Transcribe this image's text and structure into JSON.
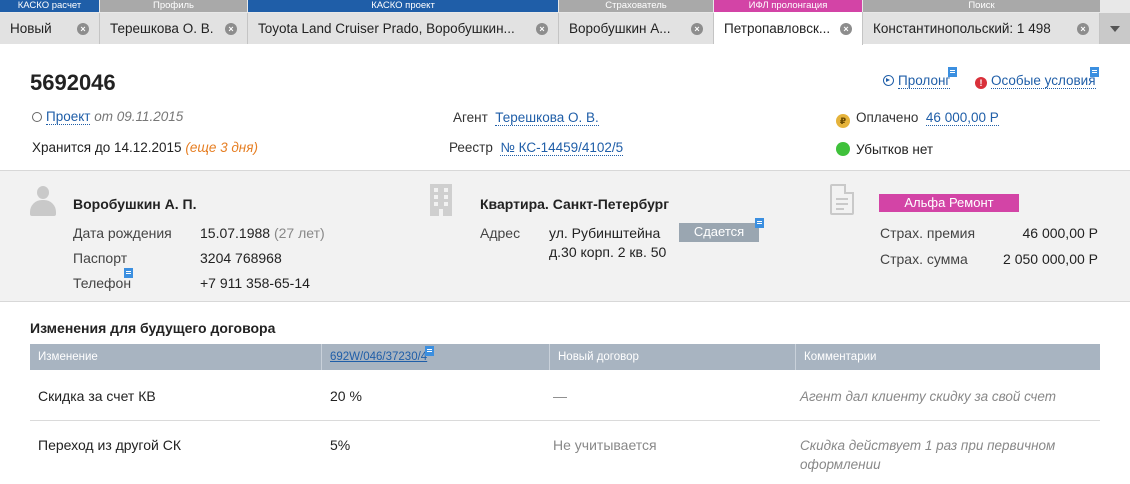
{
  "tabs": {
    "groups": [
      {
        "label": "КАСКО расчет"
      },
      {
        "label": "Профиль"
      },
      {
        "label": "КАСКО проект"
      },
      {
        "label": "Страхователь"
      },
      {
        "label": "ИФЛ пролонгация"
      },
      {
        "label": "Поиск"
      }
    ],
    "items": [
      {
        "label": "Новый"
      },
      {
        "label": "Терешкова О. В."
      },
      {
        "label": "Toyota Land Cruiser Prado, Воробушкин..."
      },
      {
        "label": "Воробушкин А..."
      },
      {
        "label": "Петропавловск..."
      },
      {
        "label": "Константинопольский: 1 498"
      }
    ],
    "close_glyph": "×"
  },
  "contract": {
    "number": "5692046",
    "status_link": "Проект",
    "status_date": "от 09.11.2015",
    "stored_until": "Хранится до 14.12.2015",
    "stored_remaining": "(еще 3 дня)",
    "agent_label": "Агент",
    "agent_name": "Терешкова О. В.",
    "registry_label": "Реестр",
    "registry_value": "№ КС-14459/4102/5",
    "paid_label": "Оплачено",
    "paid_value": "46 000,00 Р",
    "coin_symbol": "₽",
    "losses": "Убытков нет",
    "prolong_link": "Пролонг",
    "special_link": "Особые условия",
    "warn_symbol": "!"
  },
  "insured": {
    "name": "Воробушкин А. П.",
    "birth_label": "Дата рождения",
    "birth_value": "15.07.1988",
    "birth_age": "(27 лет)",
    "passport_label": "Паспорт",
    "passport_value": "3204 768968",
    "phone_label": "Телефон",
    "phone_value": "+7 911 358-65-14"
  },
  "property": {
    "title": "Квартира. Санкт-Петербург",
    "address_label": "Адрес",
    "address_line1": "ул. Рубинштейна",
    "address_line2": "д.30 корп. 2 кв. 50",
    "rent_badge": "Сдается"
  },
  "policy": {
    "program_badge": "Альфа Ремонт",
    "premium_label": "Страх. премия",
    "premium_value": "46 000,00 Р",
    "sum_label": "Страх. сумма",
    "sum_value": "2 050 000,00 Р"
  },
  "changes": {
    "title": "Изменения для будущего договора",
    "headers": {
      "change": "Изменение",
      "current": "692W/046/37230/4",
      "new": "Новый договор",
      "comments": "Комментарии"
    },
    "rows": [
      {
        "change": "Скидка за счет КВ",
        "current": "20 %",
        "new": "—",
        "comment_line1": "Агент дал клиенту скидку за свой счет",
        "comment_line2": ""
      },
      {
        "change": "Переход из другой СК",
        "current": "5%",
        "new": "Не учитывается",
        "comment_line1": "Скидка действует 1 раз при первичном",
        "comment_line2": "оформлении"
      }
    ]
  },
  "colors": {
    "brand_blue": "#1f5ea8",
    "pink": "#d344a6",
    "tab_grey": "#a9a9a9",
    "orange": "#e67e22",
    "green": "#3fc13b",
    "table_header": "#a8b4c1"
  },
  "icons": [
    "close-icon",
    "chevron-down-icon",
    "radio-icon",
    "coin-icon",
    "status-ok-icon",
    "prolong-icon",
    "warning-icon",
    "person-icon",
    "building-icon",
    "document-icon",
    "comment-icon"
  ]
}
